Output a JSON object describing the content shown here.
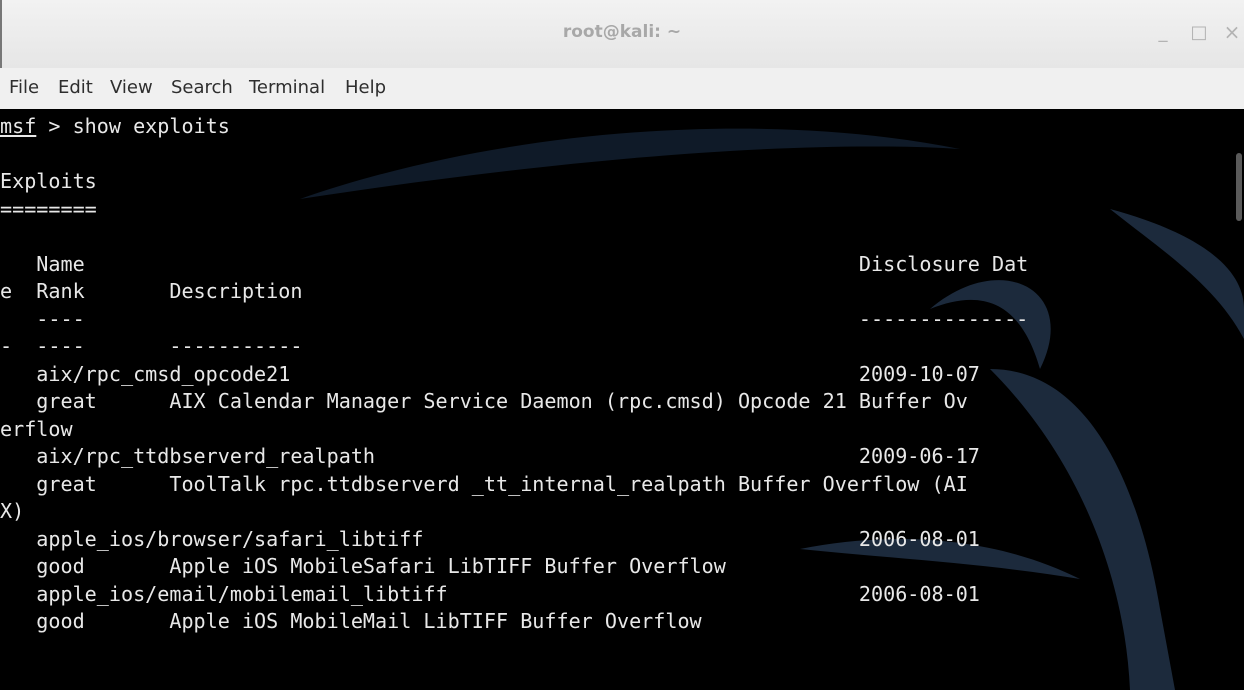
{
  "window": {
    "title": "root@kali: ~",
    "minimize_glyph": "_",
    "maximize_glyph": "□",
    "close_glyph": "×"
  },
  "menu": [
    "File",
    "Edit",
    "View",
    "Search",
    "Terminal",
    "Help"
  ],
  "terminal": {
    "prompt": "msf",
    "command": " > show exploits",
    "lines": [
      "",
      "Exploits",
      "========",
      "",
      "   Name                                                                Disclosure Dat",
      "e  Rank       Description",
      "   ----                                                                --------------",
      "-  ----       -----------",
      "   aix/rpc_cmsd_opcode21                                               2009-10-07",
      "   great      AIX Calendar Manager Service Daemon (rpc.cmsd) Opcode 21 Buffer Ov",
      "erflow",
      "   aix/rpc_ttdbserverd_realpath                                        2009-06-17",
      "   great      ToolTalk rpc.ttdbserverd _tt_internal_realpath Buffer Overflow (AI",
      "X)",
      "   apple_ios/browser/safari_libtiff                                    2006-08-01",
      "   good       Apple iOS MobileSafari LibTIFF Buffer Overflow",
      "   apple_ios/email/mobilemail_libtiff                                  2006-08-01",
      "   good       Apple iOS MobileMail LibTIFF Buffer Overflow"
    ]
  },
  "colors": {
    "background": "#000000",
    "text": "#e8e8e8",
    "dragon": "#1c2a3c"
  },
  "icons": [
    "minimize-icon",
    "maximize-icon",
    "close-icon"
  ]
}
